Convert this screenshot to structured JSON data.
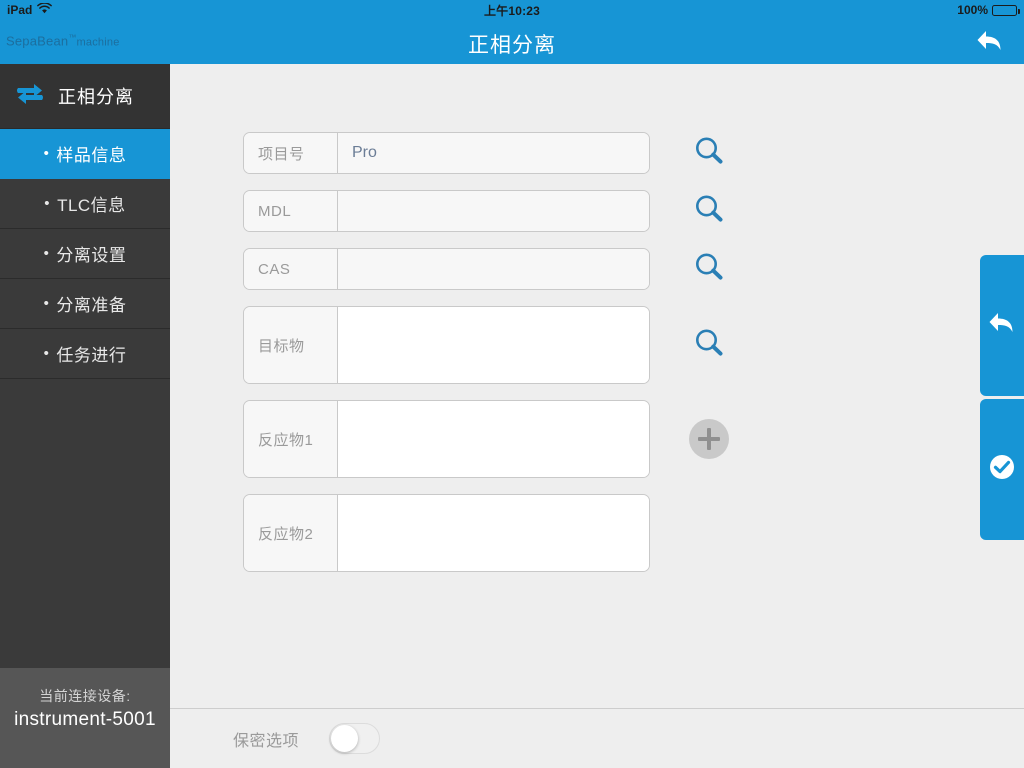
{
  "statusbar": {
    "device": "iPad",
    "wifi_icon": "wifi-icon",
    "time": "上午10:23",
    "battery_percent": "100%",
    "battery_icon": "battery-full-icon"
  },
  "navbar": {
    "brand_name": "SepaBean",
    "brand_tm": "™",
    "brand_sub": "machine",
    "title": "正相分离",
    "back_icon": "back-arrow-icon"
  },
  "sidebar": {
    "header": {
      "icon": "sync-repeat-icon",
      "label": "正相分离"
    },
    "items": [
      {
        "label": "样品信息",
        "active": true
      },
      {
        "label": "TLC信息",
        "active": false
      },
      {
        "label": "分离设置",
        "active": false
      },
      {
        "label": "分离准备",
        "active": false
      },
      {
        "label": "任务进行",
        "active": false
      }
    ],
    "bullet": "•",
    "footer": {
      "caption": "当前连接设备:",
      "device_name": "instrument-5001"
    }
  },
  "form": {
    "fields": [
      {
        "label": "项目号",
        "value": "Pro",
        "placeholder": "",
        "size": "small",
        "action": "search-icon"
      },
      {
        "label": "MDL",
        "value": "",
        "placeholder": "",
        "size": "small",
        "action": "search-icon"
      },
      {
        "label": "CAS",
        "value": "",
        "placeholder": "",
        "size": "small",
        "action": "search-icon"
      },
      {
        "label": "目标物",
        "value": "",
        "placeholder": "",
        "size": "large",
        "action": "search-icon"
      },
      {
        "label": "反应物1",
        "value": "",
        "placeholder": "",
        "size": "large",
        "action": "add-icon"
      },
      {
        "label": "反应物2",
        "value": "",
        "placeholder": "",
        "size": "large",
        "action": "none"
      }
    ]
  },
  "edge_tabs": [
    {
      "name": "undo-tab",
      "icon": "back-arrow-icon"
    },
    {
      "name": "confirm-tab",
      "icon": "check-circle-icon"
    }
  ],
  "bottom": {
    "toggle_label": "保密选项",
    "toggle_state": "off"
  },
  "colors": {
    "accent_blue": "#1795d5",
    "sidebar_dark": "#333333",
    "sidebar_item": "#3a3a3a",
    "sidebar_footer": "#565656",
    "content_bg": "#eeeeee",
    "field_border": "#c9c9c9",
    "value_text": "#6b7d96",
    "label_text": "#9a9a9a"
  }
}
